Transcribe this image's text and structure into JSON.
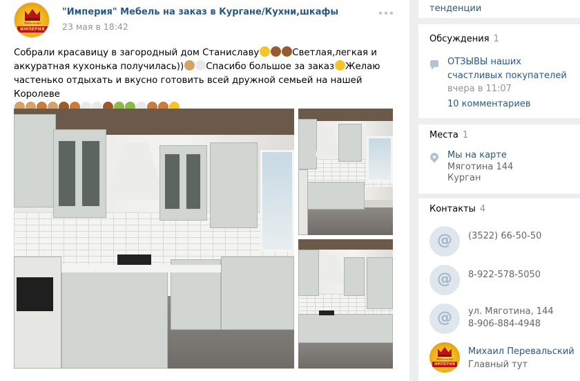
{
  "post": {
    "author": "\"Империя\" Мебель на заказ в Кургане/Кухни,шкафы",
    "date": "23 мая в 18:42",
    "avatar_text": "ИМПЕРИЯ",
    "avatar_top_text": "Мебельная фабрика",
    "text_part1": "Собрали красавицу в загородный дом Станиславу",
    "text_part2": "Светлая,легкая и аккуратная кухонька получилась))",
    "text_part3": "Спасибо большое за заказ",
    "text_part4": "Желаю частенько отдыхать и вкусно готовить всей дружной семьей на нашей Королеве"
  },
  "sidebar": {
    "top_link": "тенденции",
    "discussions": {
      "title": "Обсуждения",
      "count": "1",
      "item_title": "ОТЗЫВЫ наших счастливых покупателей",
      "item_time": "вчера в 11:07",
      "item_comments": "10 комментариев"
    },
    "places": {
      "title": "Места",
      "count": "1",
      "line1": "Мы на карте",
      "line2": "Мяготина 144",
      "line3": "Курган"
    },
    "contacts": {
      "title": "Контакты",
      "count": "4",
      "items": [
        {
          "line1": "(3522) 66-50-50"
        },
        {
          "line1": "8-922-578-5050"
        },
        {
          "line1": "ул. Мяготина, 144",
          "line2": "8-906-884-4948"
        },
        {
          "name": "Михаил Перевальский",
          "role": "Главный тут"
        }
      ],
      "at_symbol": "@"
    }
  },
  "colors": {
    "link": "#2a5885",
    "muted": "#939393",
    "background": "#edeef0"
  }
}
